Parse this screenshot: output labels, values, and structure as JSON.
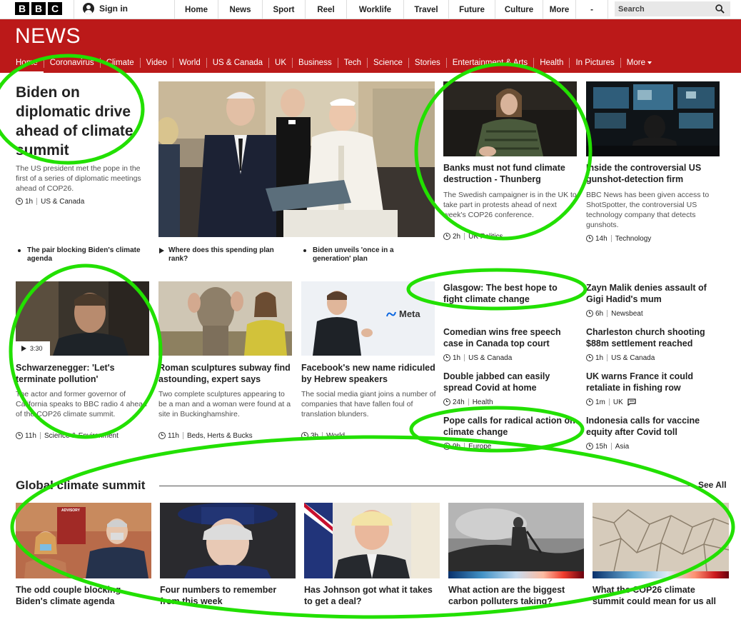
{
  "header": {
    "logo_letters": [
      "B",
      "B",
      "C"
    ],
    "signin": "Sign in",
    "nav": [
      "Home",
      "News",
      "Sport",
      "Reel",
      "Worklife",
      "Travel",
      "Future",
      "Culture",
      "More",
      "-"
    ],
    "search_placeholder": "Search"
  },
  "banner": {
    "title": "NEWS",
    "background": "#bb1919",
    "sections": [
      "Home",
      "Coronavirus",
      "Climate",
      "Video",
      "World",
      "US & Canada",
      "UK",
      "Business",
      "Tech",
      "Science",
      "Stories",
      "Entertainment & Arts",
      "Health",
      "In Pictures",
      "More"
    ]
  },
  "top": {
    "hero": {
      "headline": "Biden on diplomatic drive ahead of climate summit",
      "summary": "The US president met the pope in the first of a series of diplomatic meetings ahead of COP26.",
      "time": "1h",
      "tag": "US & Canada"
    },
    "related": [
      {
        "text": "The pair blocking Biden's climate agenda",
        "icon": "bullet"
      },
      {
        "text": "Where does this spending plan rank?",
        "icon": "play"
      },
      {
        "text": "Biden unveils 'once in a generation' plan",
        "icon": "bullet"
      }
    ],
    "s1": {
      "headline": "Banks must not fund climate destruction - Thunberg",
      "summary": "The Swedish campaigner is in the UK to take part in protests ahead of next week's COP26 conference.",
      "time": "2h",
      "tag": "UK Politics"
    },
    "s2": {
      "headline": "Inside the controversial US gunshot-detection firm",
      "summary": "BBC News has been given access to ShotSpotter, the controversial US technology company that detects gunshots.",
      "time": "14h",
      "tag": "Technology"
    }
  },
  "mid": {
    "video": {
      "duration": "3:30",
      "headline": "Schwarzenegger: 'Let's terminate pollution'",
      "summary": "The actor and former governor of California speaks to BBC radio 4 ahead of the COP26 climate summit.",
      "time": "11h",
      "tag": "Science & Environment"
    },
    "sculpture": {
      "headline": "Roman sculptures subway find astounding, expert says",
      "summary": "Two complete sculptures appearing to be a man and a woman were found at a site in Buckinghamshire.",
      "time": "11h",
      "tag": "Beds, Herts & Bucks"
    },
    "facebook": {
      "headline": "Facebook's new name ridiculed by Hebrew speakers",
      "summary": "The social media giant joins a number of companies that have fallen foul of translation blunders.",
      "time": "3h",
      "tag": "World",
      "logo_text": "Meta"
    },
    "list": [
      {
        "headline": "Glasgow: The best hope to fight climate change",
        "time": "",
        "tag": ""
      },
      {
        "headline": "Zayn Malik denies assault of Gigi Hadid's mum",
        "time": "6h",
        "tag": "Newsbeat"
      },
      {
        "headline": "Comedian wins free speech case in Canada top court",
        "time": "1h",
        "tag": "US & Canada"
      },
      {
        "headline": "Charleston church shooting $88m settlement reached",
        "time": "1h",
        "tag": "US & Canada"
      },
      {
        "headline": "Double jabbed can easily spread Covid at home",
        "time": "24h",
        "tag": "Health"
      },
      {
        "headline": "UK warns France it could retaliate in fishing row",
        "time": "1m",
        "tag": "UK"
      },
      {
        "headline": "Pope calls for radical action on climate change",
        "time": "9h",
        "tag": "Europe"
      },
      {
        "headline": "Indonesia calls for vaccine equity after Covid toll",
        "time": "15h",
        "tag": "Asia"
      }
    ]
  },
  "climate": {
    "title": "Global climate summit",
    "see_all": "See All",
    "cards": [
      {
        "headline": "The odd couple blocking Biden's climate agenda"
      },
      {
        "headline": "Four numbers to remember from this week"
      },
      {
        "headline": "Has Johnson got what it takes to get a deal?"
      },
      {
        "headline": "What action are the biggest carbon polluters taking?"
      },
      {
        "headline": "What the COP26 climate summit could mean for us all"
      }
    ],
    "adv_sign": "ADVISORY"
  },
  "annotation_color": "#22e000"
}
